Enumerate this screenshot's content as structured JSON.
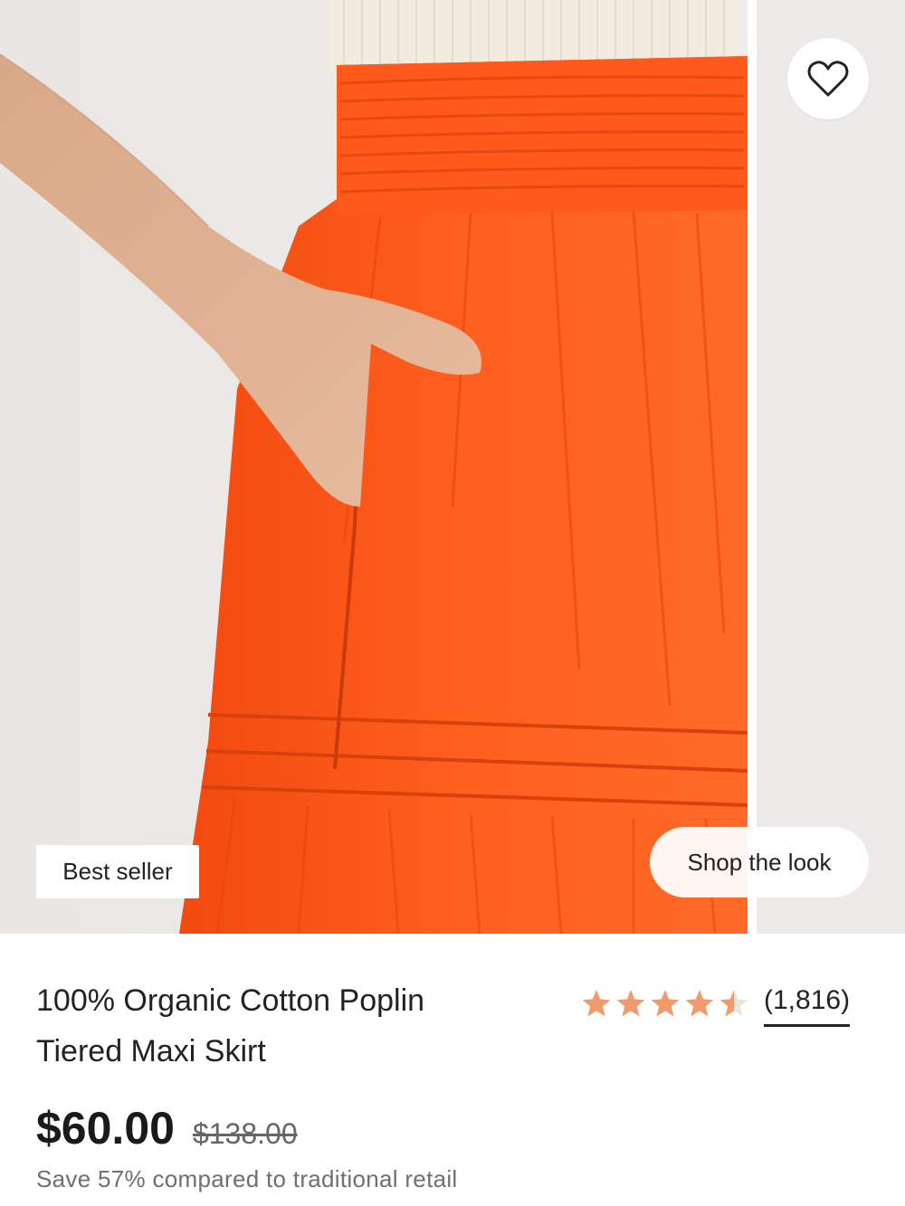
{
  "product": {
    "image_alt": "Orange tiered maxi skirt with smocked waistband",
    "badge": "Best seller",
    "shop_the_look": "Shop the look",
    "title_line1": "100% Organic Cotton Poplin",
    "title_line2": "Tiered Maxi Skirt",
    "rating": 4.5,
    "rating_max": 5,
    "review_count": "(1,816)",
    "price": "$60.00",
    "original_price": "$138.00",
    "savings_text": "Save 57% compared to traditional retail"
  },
  "colors": {
    "star": "#f29a6b",
    "skirt": "#ff5a1a",
    "text": "#222222"
  },
  "icons": {
    "favorite": "heart-outline-icon",
    "star": "star-icon"
  }
}
